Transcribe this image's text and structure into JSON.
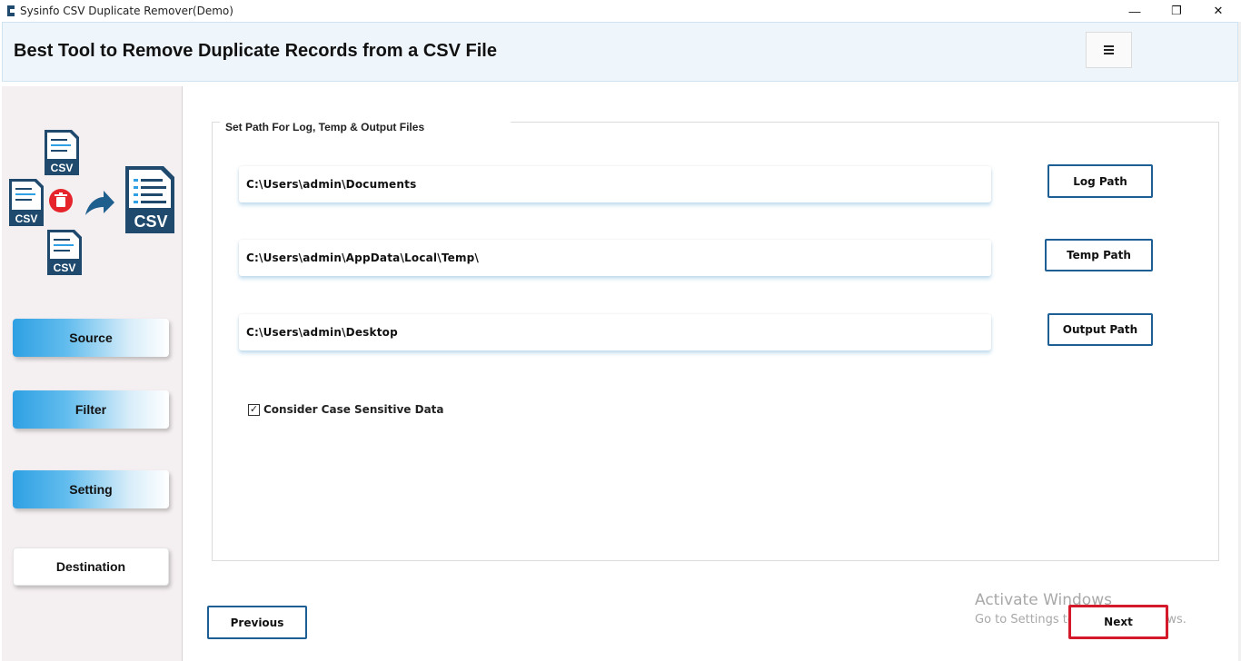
{
  "window": {
    "title": "Sysinfo CSV Duplicate Remover(Demo)",
    "controls": {
      "minimize": "—",
      "maximize": "❐",
      "close": "✕"
    }
  },
  "header": {
    "heading": "Best Tool to Remove Duplicate Records from a CSV File",
    "menu_icon": "hamburger-menu-icon"
  },
  "sidebar": {
    "illustration_labels": {
      "csv": "CSV"
    },
    "items": [
      {
        "label": "Source",
        "active": true
      },
      {
        "label": "Filter",
        "active": true
      },
      {
        "label": "Setting",
        "active": true
      },
      {
        "label": "Destination",
        "active": false
      }
    ]
  },
  "main": {
    "group_title": "Set Path For Log, Temp & Output Files",
    "paths": {
      "log": {
        "value": "C:\\Users\\admin\\Documents",
        "button": "Log Path"
      },
      "temp": {
        "value": "C:\\Users\\admin\\AppData\\Local\\Temp\\",
        "button": "Temp Path"
      },
      "output": {
        "value": "C:\\Users\\admin\\Desktop",
        "button": "Output Path"
      }
    },
    "case_sensitive": {
      "label": "Consider Case Sensitive Data",
      "checked": true,
      "mark": "✓"
    }
  },
  "footer": {
    "previous": "Previous",
    "next": "Next"
  },
  "watermark": {
    "line1": "Activate Windows",
    "line2": "Go to Settings to activate Windows."
  },
  "colors": {
    "accent_blue": "#2ea0e3",
    "button_border": "#1d5f95",
    "highlight_red": "#d3192a",
    "csv_icon_dark": "#1f4a6e"
  }
}
